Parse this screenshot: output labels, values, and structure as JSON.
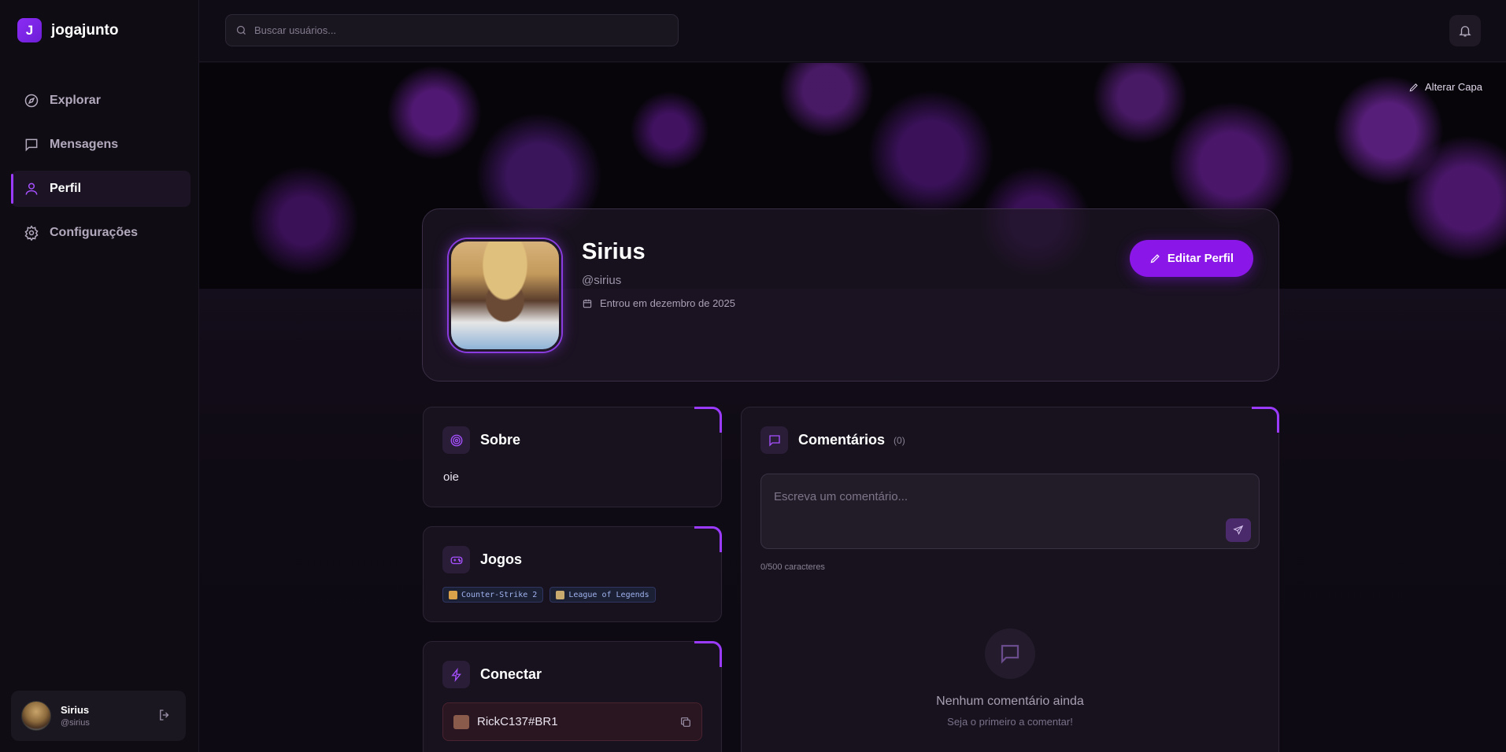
{
  "app": {
    "logo_letter": "J",
    "name": "jogajunto"
  },
  "sidebar": {
    "items": [
      {
        "label": "Explorar",
        "icon": "compass-icon"
      },
      {
        "label": "Mensagens",
        "icon": "message-square-icon"
      },
      {
        "label": "Perfil",
        "icon": "user-icon",
        "active": true
      },
      {
        "label": "Configurações",
        "icon": "gear-icon"
      }
    ],
    "user": {
      "name": "Sirius",
      "handle": "@sirius"
    }
  },
  "search": {
    "placeholder": "Buscar usuários..."
  },
  "cover": {
    "change_label": "Alterar Capa"
  },
  "profile": {
    "name": "Sirius",
    "handle": "@sirius",
    "joined": "Entrou em dezembro de 2025",
    "edit_label": "Editar Perfil"
  },
  "about": {
    "title": "Sobre",
    "text": "oie"
  },
  "games": {
    "title": "Jogos",
    "items": [
      {
        "name": "Counter-Strike 2",
        "color": "#d9a24a"
      },
      {
        "name": "League of Legends",
        "color": "#c8aa6e"
      }
    ]
  },
  "connect": {
    "title": "Conectar",
    "account": "RickC137#BR1"
  },
  "comments": {
    "title": "Comentários",
    "count": "(0)",
    "placeholder": "Escreva um comentário...",
    "char_count": "0/500 caracteres",
    "empty_title": "Nenhum comentário ainda",
    "empty_subtitle": "Seja o primeiro a comentar!"
  },
  "colors": {
    "accent": "#8a16e8",
    "accent_light": "#a650ff",
    "background": "#0e0a13"
  }
}
